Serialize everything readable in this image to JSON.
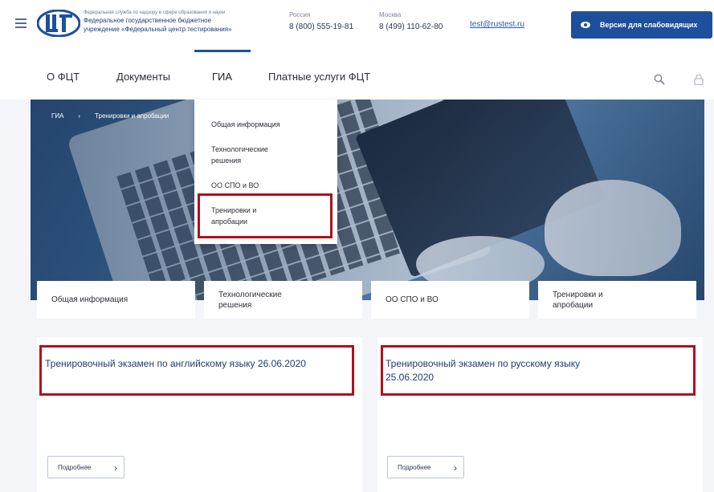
{
  "header": {
    "org_line1": "Федеральная служба по надзору в сфере образования и науки",
    "org_line2": "Федеральное государственное бюджетное",
    "org_line3": "учреждение «Федеральный центр тестирования»",
    "contacts": [
      {
        "label": "Россия",
        "phone": "8 (800) 555-19-81"
      },
      {
        "label": "Москва",
        "phone": "8 (499) 110-62-80"
      }
    ],
    "email": "test@rustest.ru",
    "vision_button": "Версия для слабовидящих"
  },
  "nav": {
    "items": [
      "О ФЦТ",
      "Документы",
      "ГИА",
      "Платные услуги ФЦТ"
    ],
    "active": "ГИА"
  },
  "breadcrumb": [
    "ГИА",
    "Тренировки и апробации"
  ],
  "dropdown": {
    "items": [
      "Общая информация",
      "Технологические решения",
      "ОО СПО и ВО",
      "Тренировки и апробации"
    ],
    "highlighted": "Тренировки и апробации"
  },
  "tiles": [
    "Общая информация",
    "Технологические решения",
    "ОО СПО и ВО",
    "Тренировки и апробации"
  ],
  "cards": [
    {
      "title": "Тренировочный экзамен по английскому языку 26.06.2020",
      "button": "Подробнее"
    },
    {
      "title": "Тренировочный экзамен по русскому языку 25.06.2020",
      "button": "Подробнее"
    }
  ],
  "icons": {
    "menu": "hamburger-icon",
    "logo": "fct-logo-icon",
    "vision": "eye-icon",
    "search": "search-icon",
    "lock": "lock-icon",
    "more": "chevron-right-icon"
  },
  "colors": {
    "brand_blue": "#1e4f9c",
    "highlight_red": "#b0101d",
    "title_blue": "#1d3d78"
  }
}
